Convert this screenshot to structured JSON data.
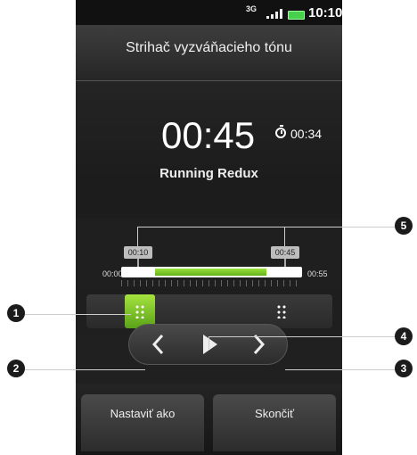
{
  "status_bar": {
    "network": "3G",
    "time": "10:10"
  },
  "header": {
    "title": "Strihač vyzváňacieho tónu"
  },
  "player": {
    "current_time": "00:45",
    "duration": "00:34",
    "song": "Running Redux"
  },
  "timeline": {
    "start_label": "00:10",
    "end_label": "00:45",
    "track_start": "00:00",
    "track_end": "00:55"
  },
  "buttons": {
    "prev_icon": "chevron-left-icon",
    "play_icon": "play-icon",
    "next_icon": "chevron-right-icon"
  },
  "softkeys": {
    "left": "Nastaviť ako",
    "right": "Skončiť"
  },
  "callouts": [
    "1",
    "2",
    "3",
    "4",
    "5"
  ],
  "colors": {
    "accent_green": "#7fca2b",
    "background": "#1c1c1c"
  }
}
